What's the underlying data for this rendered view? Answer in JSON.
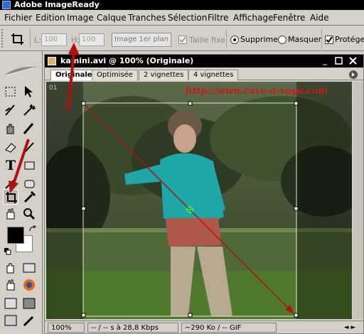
{
  "app": {
    "title": "Adobe ImageReady"
  },
  "menubar": {
    "items": [
      "Fichier",
      "Edition",
      "Image",
      "Calque",
      "Tranches",
      "Sélection",
      "Filtre",
      "Affichage",
      "Fenêtre",
      "Aide"
    ]
  },
  "options_bar": {
    "l_label": "L:",
    "l_value": "100",
    "h_label": "H:",
    "h_value": "100",
    "front_image_label": "Image 1er plan",
    "fixed_size_label": "Taille fixe",
    "fixed_size_checked": true,
    "delete_label": "Supprimer",
    "delete_selected": true,
    "hide_label": "Masquer",
    "hide_selected": false,
    "protect_label": "Protéger",
    "protect_checked": true
  },
  "document": {
    "title": "kamini.avi @ 100% (Originale)",
    "tabs": [
      "Originale",
      "Optimisée",
      "2 vignettes",
      "4 vignettes"
    ],
    "active_tab": "Originale",
    "frame_label": "01",
    "watermark": "http://www.cave-a-voyo.com"
  },
  "statusbar": {
    "zoom": "100%",
    "speed": "-- / -- s à 28,8 Kbps",
    "size": "~290 Ko / -- GIF"
  },
  "colors": {
    "foreground": "#000000",
    "background": "#ffffff",
    "annotation_arrow": "#b01010"
  }
}
